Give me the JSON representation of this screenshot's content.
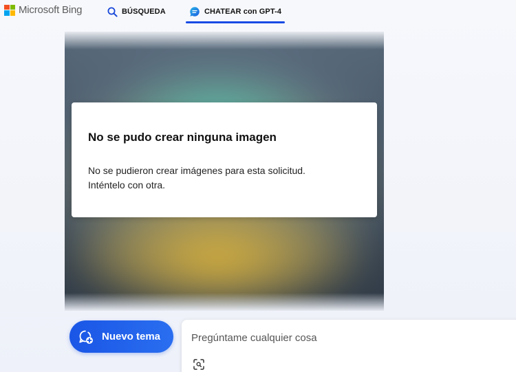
{
  "header": {
    "brand": "Microsoft Bing",
    "brand_colors": [
      "#f25022",
      "#7fba00",
      "#00a4ef",
      "#ffb900"
    ],
    "logo_icon": "microsoft-logo-icon",
    "tabs": [
      {
        "label": "BÚSQUEDA",
        "icon": "search-icon",
        "active": false
      },
      {
        "label": "CHATEAR con GPT-4",
        "icon": "chat-bubble-icon",
        "active": true
      }
    ],
    "accent_color": "#174ae4"
  },
  "image_result": {
    "state": "blurred"
  },
  "error": {
    "title": "No se pudo crear ninguna imagen",
    "message_line1": "No se pudieron crear imágenes para esta solicitud.",
    "message_line2": "Inténtelo con otra."
  },
  "new_topic": {
    "label": "Nuevo tema",
    "icon": "new-topic-icon"
  },
  "chat": {
    "placeholder": "Pregúntame cualquier cosa",
    "value": "",
    "visual_search_icon": "visual-search-icon"
  }
}
